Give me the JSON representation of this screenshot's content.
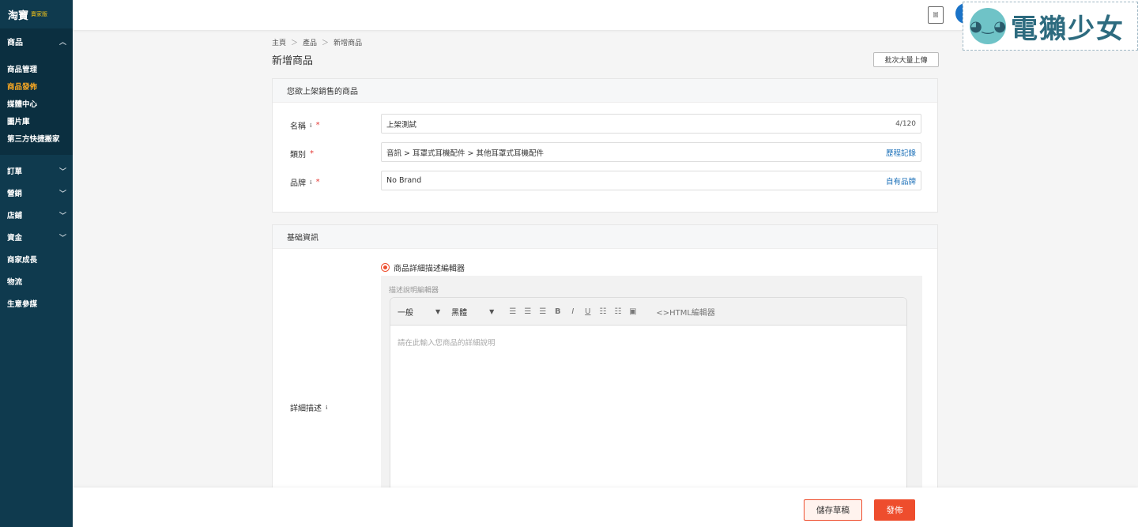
{
  "sidebar": {
    "logo": "淘寶",
    "logo_sub": "賣家版",
    "product_section": "商品",
    "product_items": [
      "商品管理",
      "商品發佈",
      "媒體中心",
      "圖片庫",
      "第三方快捷搬家"
    ],
    "sections": [
      "訂單",
      "營銷",
      "店鋪",
      "資金"
    ],
    "plain_items": [
      "商家成長",
      "物流",
      "生意參謀"
    ]
  },
  "topbar": {
    "doc_icon_text": "圖",
    "watermark": "電獺少女"
  },
  "breadcrumb": [
    "主頁",
    "產品",
    "新增商品"
  ],
  "page_title": "新增商品",
  "bulk_upload": "批次大量上傳",
  "card1": {
    "title": "您欲上架銷售的商品",
    "name_label": "名稱",
    "name_value": "上架測試",
    "name_counter": "4/120",
    "category_label": "類別",
    "category_value": "音訊 > 耳罩式耳機配件 > 其他耳罩式耳機配件",
    "category_link": "歷程記錄",
    "brand_label": "品牌",
    "brand_value": "No Brand",
    "brand_link": "自有品牌"
  },
  "card2": {
    "title": "基础資訊",
    "radio_label": "商品詳細描述編輯器",
    "editor_label": "描述說明編輯器",
    "toolbar": {
      "format": "一般",
      "font": "黑體",
      "html_editor": "<>HTML編輯器"
    },
    "placeholder": "請在此輸入您商品的詳細說明",
    "detail_label": "詳細描述"
  },
  "footer": {
    "save_draft": "儲存草稿",
    "publish": "發佈"
  },
  "colors": {
    "sidebar_bg": "#0f3a4e",
    "accent": "#ee4d2d",
    "active_item": "#f5a623",
    "link": "#1a6fb8"
  }
}
